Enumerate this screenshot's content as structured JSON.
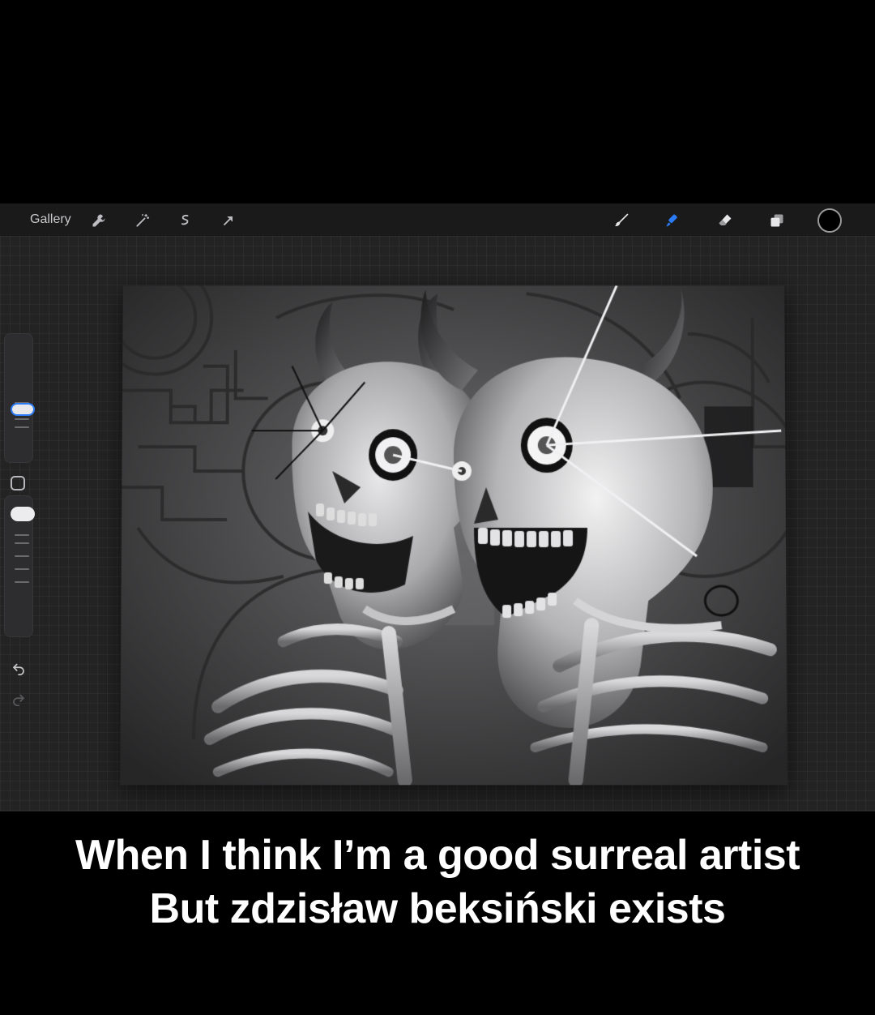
{
  "toolbar": {
    "gallery_label": "Gallery",
    "left_icons": [
      "wrench-icon",
      "magic-wand-icon",
      "selection-icon",
      "transform-arrow-icon"
    ],
    "right_icons": [
      "brush-icon",
      "smudge-icon",
      "eraser-icon",
      "layers-icon"
    ],
    "active_tool": "smudge",
    "active_color": "#2a7bf5",
    "current_color": "#000000"
  },
  "sidebar": {
    "brush_size_level": 0.45,
    "opacity_level": 0.08
  },
  "caption": {
    "line1": "When I think I’m a good surreal artist",
    "line2": "But zdzisław beksiński exists"
  }
}
